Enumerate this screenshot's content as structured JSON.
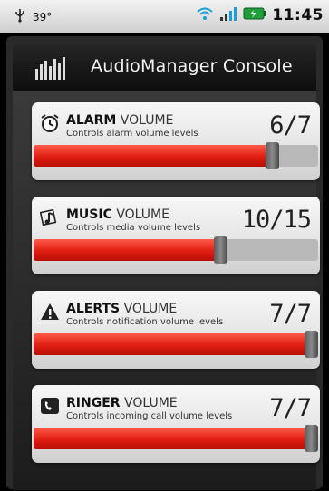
{
  "status_bar": {
    "left_text": "39°",
    "time": "11:45",
    "icons": [
      "usb-icon",
      "wifi-icon",
      "signal-icon",
      "battery-icon"
    ]
  },
  "app": {
    "title": "AudioManager Console"
  },
  "colors": {
    "fill": "#e01e12",
    "track": "#b9b9b9",
    "thumb": "#6a6a6a"
  },
  "volumes": [
    {
      "id": "alarm",
      "icon": "alarm-clock-icon",
      "name": "ALARM",
      "suffix": "VOLUME",
      "description": "Controls alarm volume levels",
      "level_text": "6/7",
      "value": 6,
      "max": 7
    },
    {
      "id": "music",
      "icon": "music-note-icon",
      "name": "MUSIC",
      "suffix": "VOLUME",
      "description": "Controls media volume levels",
      "level_text": "10/15",
      "value": 10,
      "max": 15
    },
    {
      "id": "alerts",
      "icon": "warning-icon",
      "name": "ALERTS",
      "suffix": "VOLUME",
      "description": "Controls notification volume levels",
      "level_text": "7/7",
      "value": 7,
      "max": 7
    },
    {
      "id": "ringer",
      "icon": "phone-icon",
      "name": "RINGER",
      "suffix": "VOLUME",
      "description": "Controls incoming call volume levels",
      "level_text": "7/7",
      "value": 7,
      "max": 7
    }
  ]
}
